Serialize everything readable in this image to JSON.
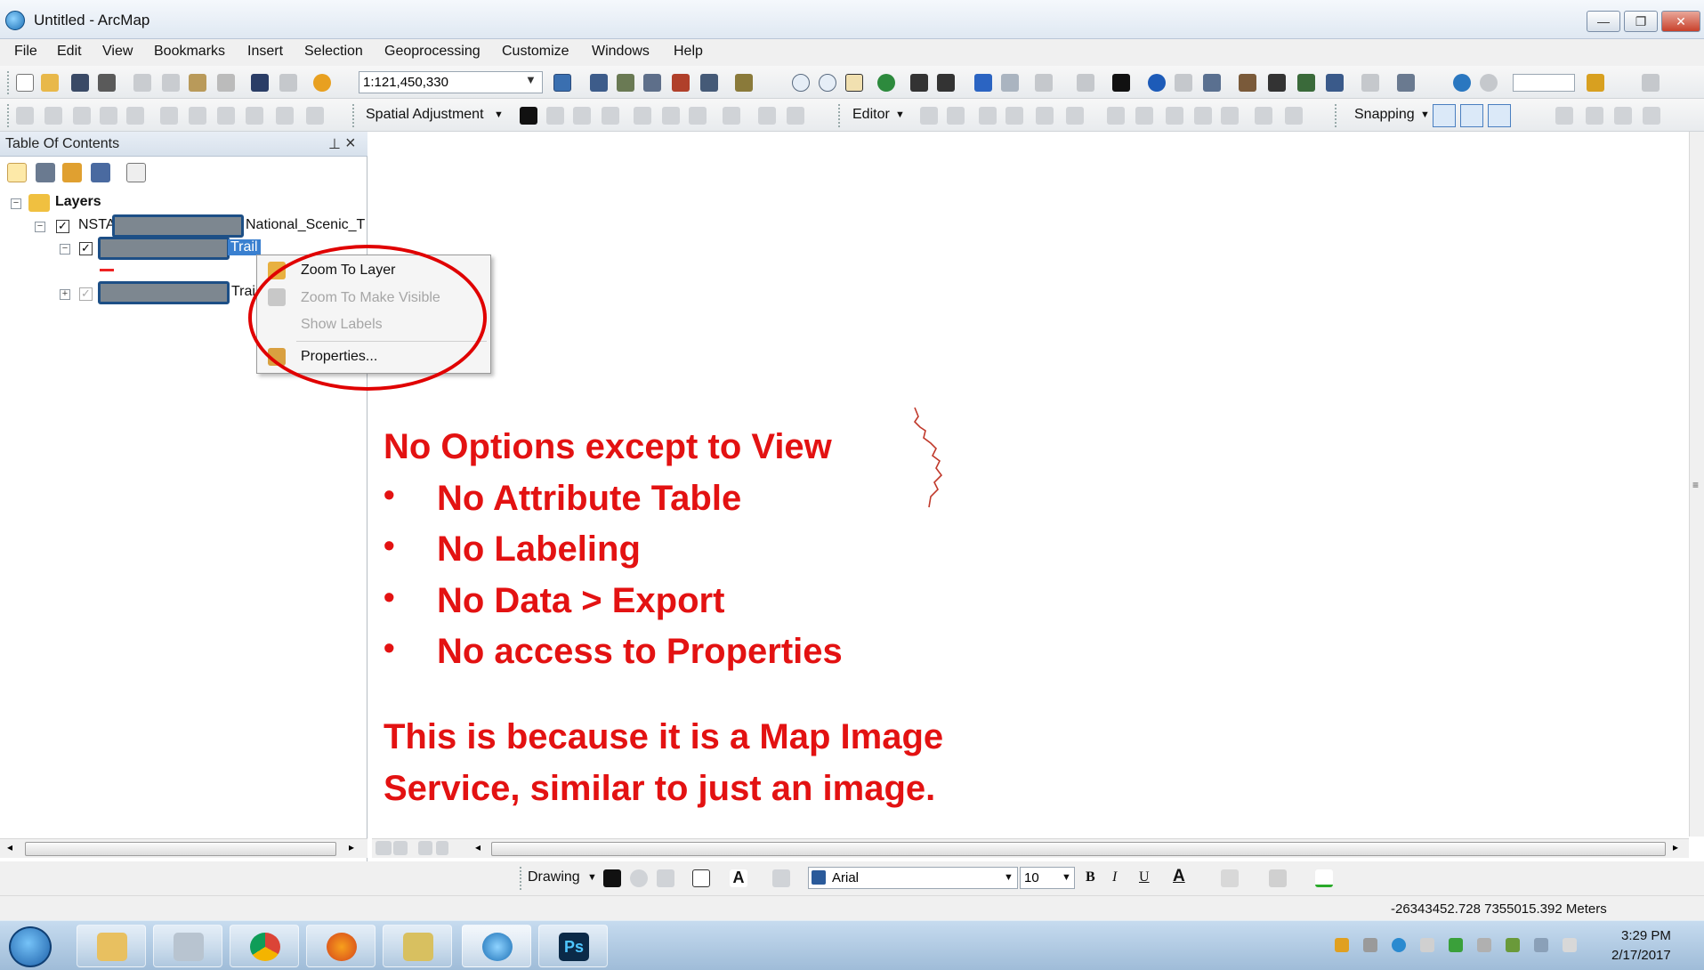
{
  "window": {
    "title": "Untitled - ArcMap"
  },
  "menubar": {
    "items": [
      "File",
      "Edit",
      "View",
      "Bookmarks",
      "Insert",
      "Selection",
      "Geoprocessing",
      "Customize",
      "Windows",
      "Help"
    ]
  },
  "toolbar": {
    "scale_value": "1:121,450,330",
    "spatial_adjustment_label": "Spatial Adjustment",
    "editor_label": "Editor",
    "snapping_label": "Snapping"
  },
  "toc": {
    "title": "Table Of Contents",
    "root_label": "Layers",
    "layer_prefix": "NSTA",
    "layer_suffix": "National_Scenic_T",
    "sublayer1_label": "Trail",
    "sublayer2_label": "Trai"
  },
  "context_menu": {
    "items": [
      {
        "label": "Zoom To Layer",
        "enabled": true
      },
      {
        "label": "Zoom To Make Visible",
        "enabled": false
      },
      {
        "label": "Show Labels",
        "enabled": false
      },
      {
        "label": "Properties...",
        "enabled": true
      }
    ]
  },
  "annotation": {
    "heading": "No Options except to View",
    "bullets": [
      "No Attribute Table",
      "No Labeling",
      "No Data > Export",
      "No access to Properties"
    ],
    "explanation_line1": "This is because it is a Map Image",
    "explanation_line2": "Service, similar to just an image.",
    "color": "#e31212"
  },
  "drawing_toolbar": {
    "drawing_label": "Drawing",
    "font_name": "Arial",
    "font_size": "10"
  },
  "statusbar": {
    "coordinates": "-26343452.728  7355015.392 Meters"
  },
  "taskbar": {
    "time": "3:29 PM",
    "date": "2/17/2017"
  }
}
